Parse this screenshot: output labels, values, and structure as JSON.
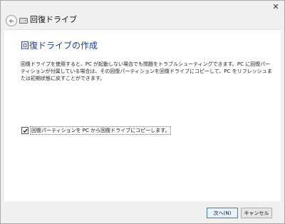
{
  "window": {
    "title": "回復ドライブ",
    "close_glyph": "✕"
  },
  "page": {
    "heading": "回復ドライブの作成",
    "description": "回復ドライブを使用すると、PC が起動しない場合でも問題をトラブルシューティングできます。PC に回復パーティションが付属している場合は、その回復パーティションを回復ドライブにコピーして、PC をリフレッシュまたは初期状態に戻すことができます。",
    "copy_partition": {
      "label": "回復パーティションを PC から回復ドライブにコピーします。",
      "checked": true
    }
  },
  "footer": {
    "next_label": "次へ(N)",
    "cancel_label": "キャンセル"
  },
  "icons": {
    "back": "back-arrow-icon",
    "drive": "drive-icon",
    "close": "close-icon",
    "check": "checkmark-icon"
  }
}
